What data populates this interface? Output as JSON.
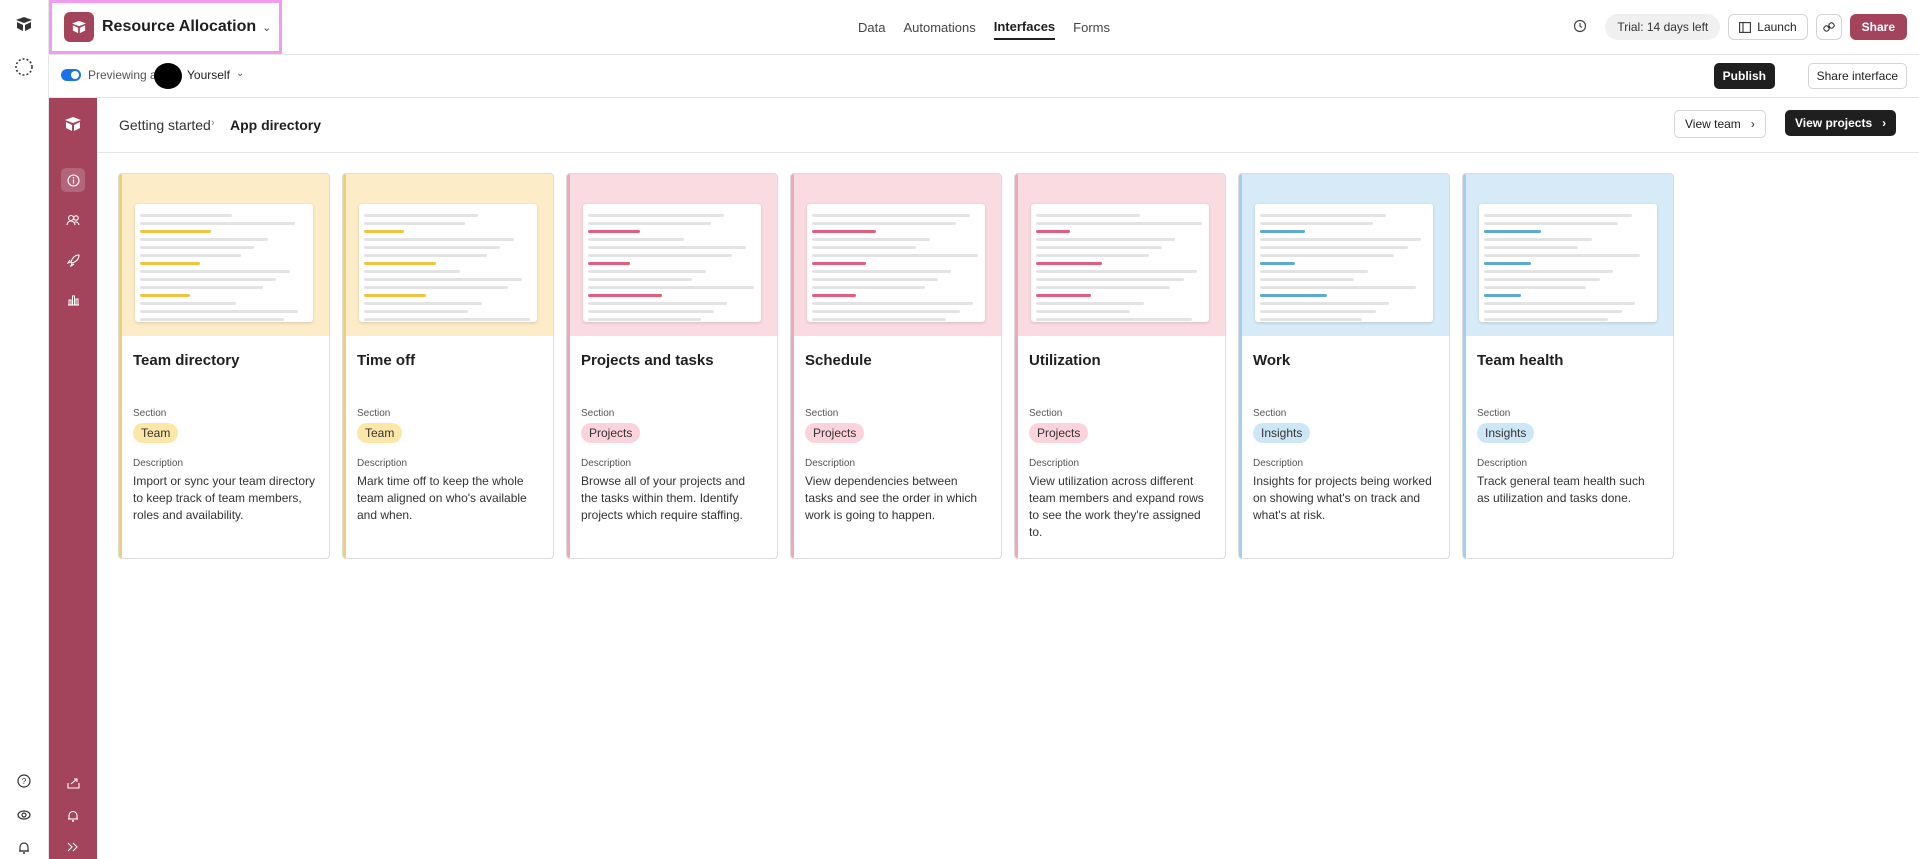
{
  "topbar": {
    "base_name": "Resource Allocation",
    "tabs": [
      {
        "label": "Data",
        "active": false
      },
      {
        "label": "Automations",
        "active": false
      },
      {
        "label": "Interfaces",
        "active": true
      },
      {
        "label": "Forms",
        "active": false
      }
    ],
    "trial": "Trial: 14 days left",
    "launch": "Launch",
    "share": "Share"
  },
  "preview": {
    "label": "Previewing as",
    "user": "Yourself",
    "publish": "Publish",
    "share_interface": "Share interface"
  },
  "page": {
    "breadcrumb_parent": "Getting started",
    "breadcrumb_current": "App directory",
    "view_team": "View team",
    "view_projects": "View projects"
  },
  "colors": {
    "brand": "#a3445c",
    "team_bg": "#fdecc8",
    "team_pill": "#fde7a8",
    "projects_bg": "#fbdbe2",
    "projects_pill": "#fbd3dc",
    "insights_bg": "#d6ebf7",
    "insights_pill": "#cde7f7"
  },
  "cards": [
    {
      "title": "Team directory",
      "section_label": "Section",
      "section": "Team",
      "tone": "team",
      "desc_label": "Description",
      "description": "Import or sync your team directory to keep track of team members, roles and availability."
    },
    {
      "title": "Time off",
      "section_label": "Section",
      "section": "Team",
      "tone": "team",
      "desc_label": "Description",
      "description": "Mark time off to keep the whole team aligned on who's available and when."
    },
    {
      "title": "Projects and tasks",
      "section_label": "Section",
      "section": "Projects",
      "tone": "projects",
      "desc_label": "Description",
      "description": "Browse all of your projects and the tasks within them. Identify projects which require staffing."
    },
    {
      "title": "Schedule",
      "section_label": "Section",
      "section": "Projects",
      "tone": "projects",
      "desc_label": "Description",
      "description": "View dependencies between tasks and see the order in which work is going to happen."
    },
    {
      "title": "Utilization",
      "section_label": "Section",
      "section": "Projects",
      "tone": "projects",
      "desc_label": "Description",
      "description": "View utilization across different team members and expand rows to see the work they're assigned to."
    },
    {
      "title": "Work",
      "section_label": "Section",
      "section": "Insights",
      "tone": "insights",
      "desc_label": "Description",
      "description": "Insights for projects being worked on showing what's on track and what's at risk."
    },
    {
      "title": "Team health",
      "section_label": "Section",
      "section": "Insights",
      "tone": "insights",
      "desc_label": "Description",
      "description": "Track general team health such as utilization and tasks done."
    }
  ]
}
